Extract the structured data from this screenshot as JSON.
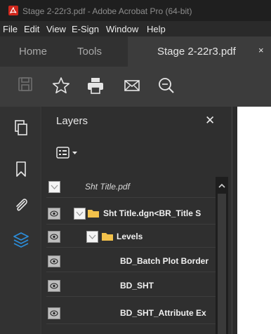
{
  "window": {
    "title": "Stage 2-22r3.pdf - Adobe Acrobat Pro (64-bit)"
  },
  "menu": {
    "items": [
      "File",
      "Edit",
      "View",
      "E-Sign",
      "Window",
      "Help"
    ]
  },
  "tabs": {
    "home": "Home",
    "tools": "Tools",
    "document": "Stage 2-22r3.pdf",
    "close": "×"
  },
  "toolbar": {
    "icons": [
      "save-icon",
      "star-icon",
      "print-icon",
      "mail-icon",
      "zoom-icon"
    ]
  },
  "left_rail": {
    "icons": [
      "page-thumbnails-icon",
      "bookmark-icon",
      "attachment-icon",
      "layers-icon"
    ],
    "active": "layers-icon",
    "active_color": "#2c8dd9"
  },
  "layers_panel": {
    "title": "Layers",
    "close": "✕",
    "rows": [
      {
        "label": "Sht Title.pdf",
        "level": 0,
        "has_eye": false,
        "has_folder": false,
        "style": "italic"
      },
      {
        "label": "Sht Title.dgn<BR_Title S",
        "level": 1,
        "has_eye": true,
        "has_folder": true,
        "style": "bold"
      },
      {
        "label": "Levels",
        "level": 2,
        "has_eye": true,
        "has_folder": true,
        "style": "bold"
      },
      {
        "label": "BD_Batch Plot Border",
        "level": 3,
        "has_eye": true,
        "has_folder": false,
        "style": "bold"
      },
      {
        "label": "BD_SHT",
        "level": 3,
        "has_eye": true,
        "has_folder": false,
        "style": "bold"
      },
      {
        "label": "BD_SHT_Attribute Ex",
        "level": 3,
        "has_eye": true,
        "has_folder": false,
        "style": "bold"
      }
    ]
  },
  "colors": {
    "titlebar": "#1f1f1f",
    "panel": "#2f2f2f",
    "folder": "#f2c14b",
    "acrobat_red": "#d0281d"
  }
}
